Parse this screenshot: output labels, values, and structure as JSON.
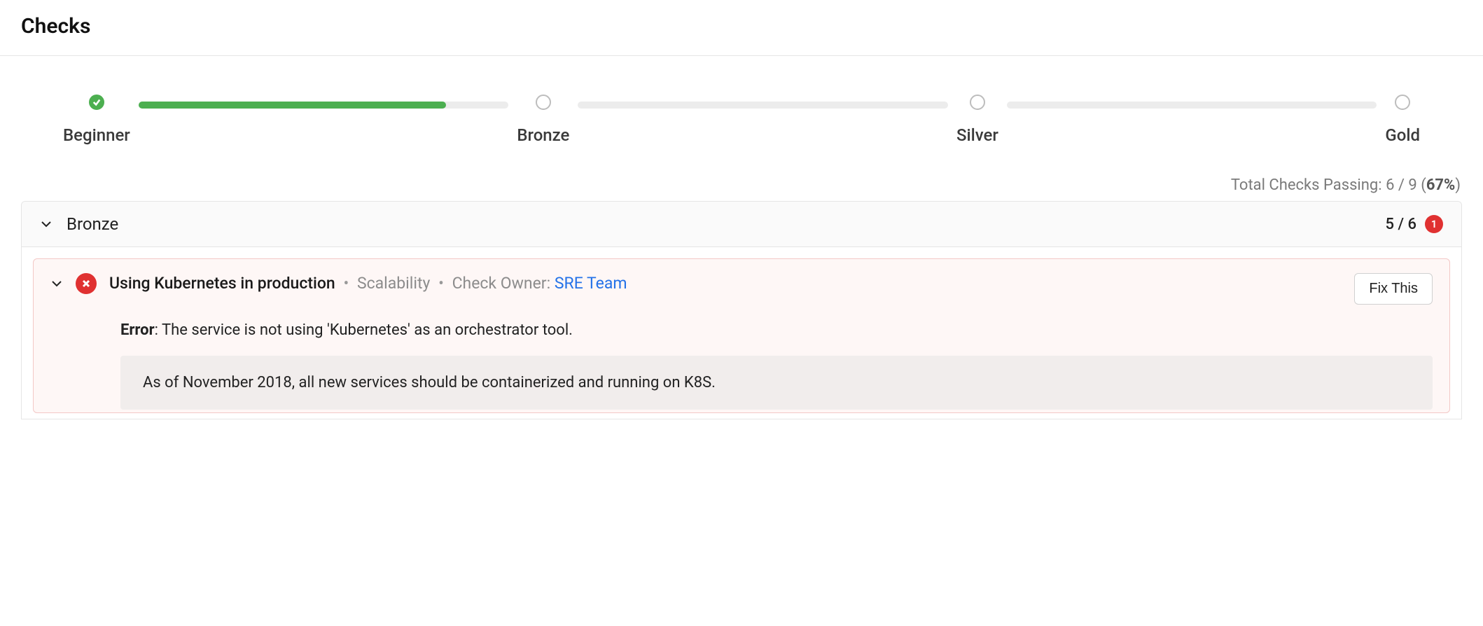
{
  "page_title": "Checks",
  "levels": [
    {
      "label": "Beginner",
      "done": true
    },
    {
      "label": "Bronze",
      "done": false
    },
    {
      "label": "Silver",
      "done": false
    },
    {
      "label": "Gold",
      "done": false
    }
  ],
  "progress": {
    "bar0_fill": "83%"
  },
  "summary": {
    "prefix": "Total Checks Passing: ",
    "value": "6 / 9",
    "pct": "67%"
  },
  "section": {
    "title": "Bronze",
    "count": "5 / 6",
    "badge": "1"
  },
  "check": {
    "title": "Using Kubernetes in production",
    "category": "Scalability",
    "owner_label": "Check Owner: ",
    "owner_name": "SRE Team",
    "fix_button": "Fix This",
    "error_label": "Error",
    "error_message": ": The service is not using 'Kubernetes' as an orchestrator tool.",
    "note": "As of November 2018, all new services should be containerized and running on K8S."
  }
}
